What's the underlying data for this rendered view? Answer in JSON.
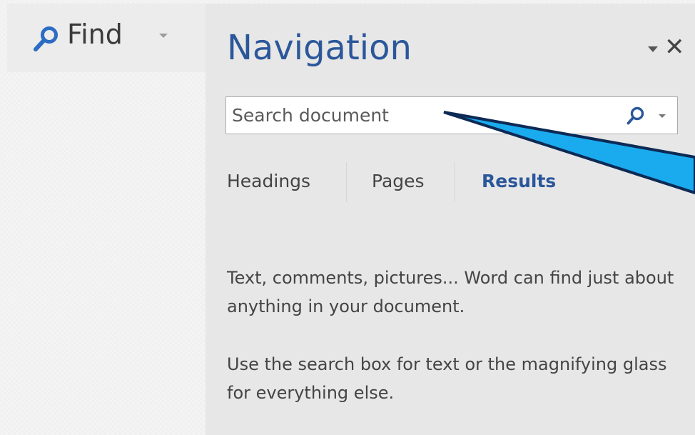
{
  "ribbon": {
    "find_label": "Find",
    "find_icon": "magnifier-icon"
  },
  "navigation": {
    "title": "Navigation",
    "close_glyph": "✕",
    "search": {
      "placeholder": "Search document"
    },
    "tabs": [
      {
        "label": "Headings",
        "active": false
      },
      {
        "label": "Pages",
        "active": false
      },
      {
        "label": "Results",
        "active": true
      }
    ],
    "help_text_1": "Text, comments, pictures... Word can find just about anything in your document.",
    "help_text_2": "Use the search box for text or the magnifying glass for everything else."
  },
  "colors": {
    "accent": "#2b579a",
    "callout_fill": "#1aabef",
    "callout_stroke": "#0d2a55"
  }
}
